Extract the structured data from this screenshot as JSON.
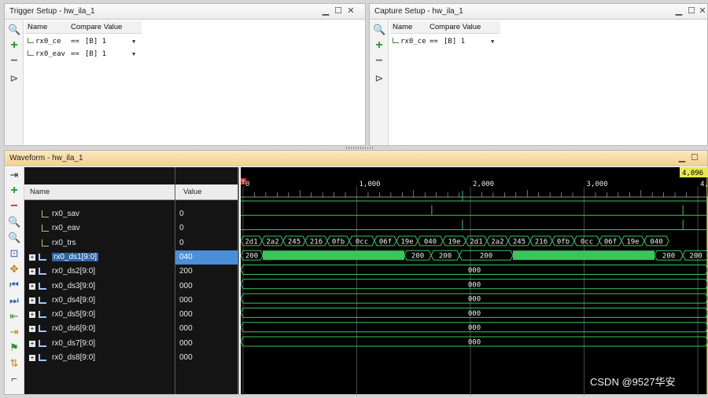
{
  "trigger_setup": {
    "title": "Trigger Setup - hw_ila_1",
    "columns": [
      "Name",
      "Compare Value"
    ],
    "rows": [
      {
        "name": "rx0_ce",
        "op": "==",
        "value": "[B] 1"
      },
      {
        "name": "rx0_eav",
        "op": "==",
        "value": "[B] 1"
      }
    ]
  },
  "capture_setup": {
    "title": "Capture Setup - hw_ila_1",
    "columns": [
      "Name",
      "Compare Value"
    ],
    "rows": [
      {
        "name": "rx0_ce",
        "op": "==",
        "value": "[B] 1"
      }
    ]
  },
  "waveform": {
    "title": "Waveform - hw_ila_1",
    "columns": {
      "name": "Name",
      "value": "Value"
    },
    "marker": "4,096",
    "trigger_marker": "T",
    "ticks": [
      "0",
      "1,000",
      "2,000",
      "3,000",
      "4,"
    ],
    "signals": [
      {
        "name": "rx0_sav",
        "value": "0",
        "type": "bit"
      },
      {
        "name": "rx0_eav",
        "value": "0",
        "type": "bit"
      },
      {
        "name": "rx0_trs",
        "value": "0",
        "type": "bit"
      },
      {
        "name": "rx0_ds1[9:0]",
        "value": "040",
        "type": "bus"
      },
      {
        "name": "rx0_ds2[9:0]",
        "value": "200",
        "type": "bus"
      },
      {
        "name": "rx0_ds3[9:0]",
        "value": "000",
        "type": "bus"
      },
      {
        "name": "rx0_ds4[9:0]",
        "value": "000",
        "type": "bus"
      },
      {
        "name": "rx0_ds5[9:0]",
        "value": "000",
        "type": "bus"
      },
      {
        "name": "rx0_ds6[9:0]",
        "value": "000",
        "type": "bus"
      },
      {
        "name": "rx0_ds7[9:0]",
        "value": "000",
        "type": "bus"
      },
      {
        "name": "rx0_ds8[9:0]",
        "value": "000",
        "type": "bus"
      }
    ],
    "ds1_segments": [
      "2d1",
      "2a2",
      "245",
      "216",
      "0fb",
      "0cc",
      "06f",
      "19e",
      "040",
      "19e",
      "2d1",
      "2a2",
      "245",
      "216",
      "0fb",
      "0cc",
      "06f",
      "19e",
      "040"
    ],
    "ds2_segments": [
      "200",
      "200",
      "200",
      "200",
      "200",
      "200"
    ],
    "const_value": "000"
  },
  "watermark": "CSDN @9527华安",
  "colors": {
    "wave_green": "#39c55a",
    "marker_yellow": "#e8e84a",
    "selection_blue": "#4a8fd8"
  }
}
